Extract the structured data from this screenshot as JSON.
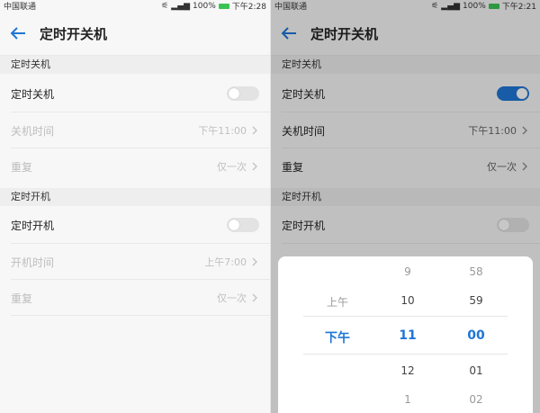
{
  "colors": {
    "accent": "#1f75d6",
    "battery": "#3ac355"
  },
  "left": {
    "status": {
      "carrier": "中国联通",
      "battery": "100%",
      "time": "下午2:28"
    },
    "header": {
      "title": "定时开关机"
    },
    "off_section": {
      "title": "定时关机"
    },
    "off_toggle": {
      "label": "定时关机",
      "on": false
    },
    "off_time": {
      "label": "关机时间",
      "value": "下午11:00"
    },
    "off_repeat": {
      "label": "重复",
      "value": "仅一次"
    },
    "on_section": {
      "title": "定时开机"
    },
    "on_toggle": {
      "label": "定时开机",
      "on": false
    },
    "on_time": {
      "label": "开机时间",
      "value": "上午7:00"
    },
    "on_repeat": {
      "label": "重复",
      "value": "仅一次"
    }
  },
  "right": {
    "status": {
      "carrier": "中国联通",
      "battery": "100%",
      "time": "下午2:21"
    },
    "header": {
      "title": "定时开关机"
    },
    "off_section": {
      "title": "定时关机"
    },
    "off_toggle": {
      "label": "定时关机",
      "on": true
    },
    "off_time": {
      "label": "关机时间",
      "value": "下午11:00"
    },
    "off_repeat": {
      "label": "重复",
      "value": "仅一次"
    },
    "on_section": {
      "title": "定时开机"
    },
    "on_toggle": {
      "label": "定时开机",
      "on": false
    },
    "picker": {
      "ampm": {
        "above": "上午",
        "selected": "下午"
      },
      "hour": {
        "above2": "9",
        "above1": "10",
        "selected": "11",
        "below1": "12",
        "below2": "1"
      },
      "minute": {
        "above2": "58",
        "above1": "59",
        "selected": "00",
        "below1": "01",
        "below2": "02"
      }
    }
  }
}
